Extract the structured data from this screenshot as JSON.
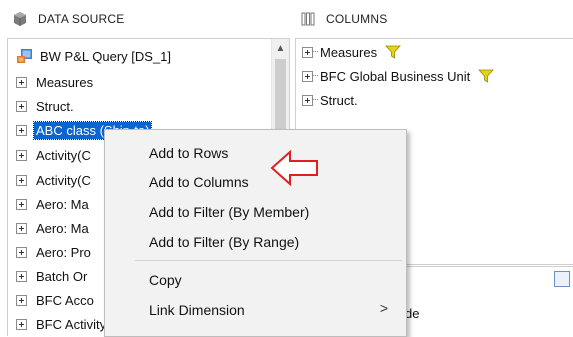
{
  "data_source": {
    "header": "DATA SOURCE",
    "root": "BW P&L Query [DS_1]",
    "items": [
      "Measures",
      "Struct.",
      "ABC class (Ship-to)",
      "Activity(C",
      "Activity(C",
      "Aero: Ma",
      "Aero: Ma",
      "Aero: Pro",
      "Batch Or",
      "BFC Acco",
      "BFC Activity"
    ]
  },
  "columns": {
    "header": "COLUMNS",
    "items": [
      "Measures",
      "BFC Global Business Unit",
      "Struct."
    ],
    "lower_text": "de"
  },
  "context_menu": {
    "items": [
      "Add to Rows",
      "Add to Columns",
      "Add to Filter (By Member)",
      "Add to Filter (By Range)",
      "Copy",
      "Link Dimension"
    ],
    "submenu_arrow": ">"
  },
  "colors": {
    "selection": "#0a64d1",
    "filter_icon": "#e6d21a",
    "annotation_arrow": "#e02020"
  }
}
